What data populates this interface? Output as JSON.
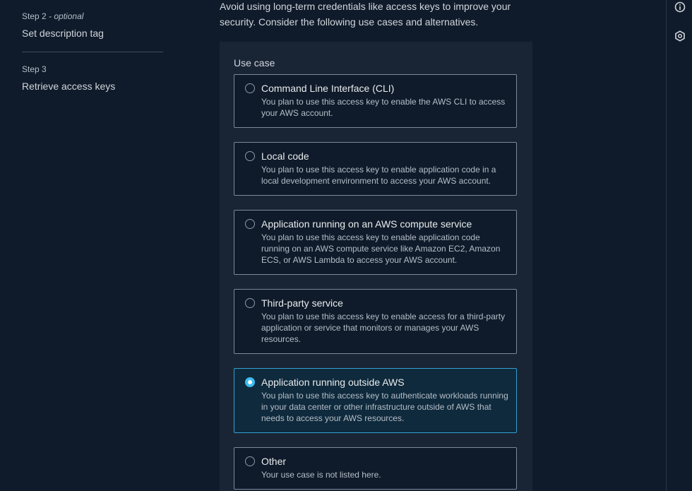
{
  "steps": [
    {
      "kicker": "Step 2",
      "kicker_suffix": " - optional",
      "title": "Set description tag"
    },
    {
      "kicker": "Step 3",
      "kicker_suffix": "",
      "title": "Retrieve access keys"
    }
  ],
  "intro": "Avoid using long-term credentials like access keys to improve your security. Consider the following use cases and alternatives.",
  "use_case": {
    "label": "Use case",
    "options": [
      {
        "title": "Command Line Interface (CLI)",
        "desc": "You plan to use this access key to enable the AWS CLI to access your AWS account.",
        "selected": false
      },
      {
        "title": "Local code",
        "desc": "You plan to use this access key to enable application code in a local development environment to access your AWS account.",
        "selected": false
      },
      {
        "title": "Application running on an AWS compute service",
        "desc": "You plan to use this access key to enable application code running on an AWS compute service like Amazon EC2, Amazon ECS, or AWS Lambda to access your AWS account.",
        "selected": false
      },
      {
        "title": "Third-party service",
        "desc": "You plan to use this access key to enable access for a third-party application or service that monitors or manages your AWS resources.",
        "selected": false
      },
      {
        "title": "Application running outside AWS",
        "desc": "You plan to use this access key to authenticate workloads running in your data center or other infrastructure outside of AWS that needs to access your AWS resources.",
        "selected": true
      },
      {
        "title": "Other",
        "desc": "Your use case is not listed here.",
        "selected": false
      }
    ]
  },
  "rail": {
    "icons": [
      "info-icon",
      "hexagon-icon"
    ]
  },
  "colors": {
    "background": "#0f1b2a",
    "panel": "#192534",
    "selected_border": "#33a0d0",
    "radio_selected": "#3dbcf2"
  }
}
